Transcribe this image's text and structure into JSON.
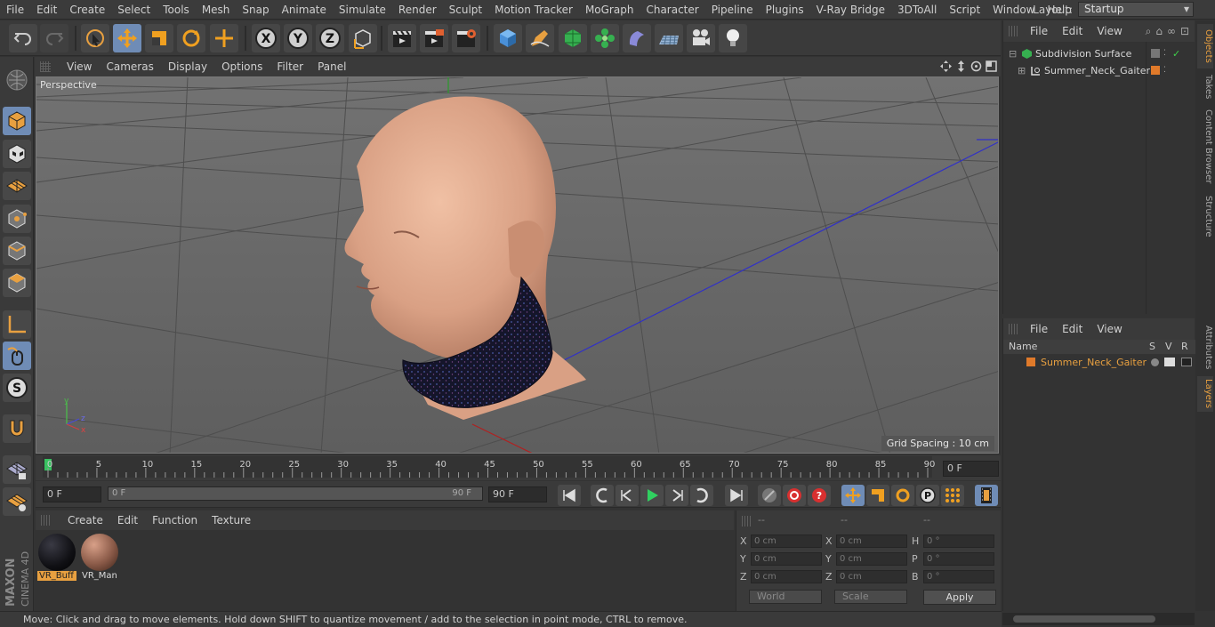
{
  "menubar": {
    "items": [
      "File",
      "Edit",
      "Create",
      "Select",
      "Tools",
      "Mesh",
      "Snap",
      "Animate",
      "Simulate",
      "Render",
      "Sculpt",
      "Motion Tracker",
      "MoGraph",
      "Character",
      "Pipeline",
      "Plugins",
      "V-Ray Bridge",
      "3DToAll",
      "Script",
      "Window",
      "Help"
    ],
    "layout_label": "Layout:",
    "layout_value": "Startup"
  },
  "toolbar": {
    "axis_x": "X",
    "axis_y": "Y",
    "axis_z": "Z"
  },
  "viewport": {
    "menu": [
      "View",
      "Cameras",
      "Display",
      "Options",
      "Filter",
      "Panel"
    ],
    "label": "Perspective",
    "grid_spacing": "Grid Spacing : 10 cm",
    "axis_y": "y",
    "axis_z": "z",
    "axis_x": "x"
  },
  "timeline": {
    "ticks": [
      "0",
      "5",
      "10",
      "15",
      "20",
      "25",
      "30",
      "35",
      "40",
      "45",
      "50",
      "55",
      "60",
      "65",
      "70",
      "75",
      "80",
      "85",
      "90"
    ],
    "current_frame": "0 F"
  },
  "transport": {
    "start_field": "0 F",
    "range_start": "0 F",
    "range_end": "90 F",
    "end_field": "90 F"
  },
  "materials": {
    "menu": [
      "Create",
      "Edit",
      "Function",
      "Texture"
    ],
    "items": [
      {
        "label": "VR_Buff",
        "color": "#101014"
      },
      {
        "label": "VR_Man",
        "color": "#8a5a48"
      }
    ]
  },
  "coordinates": {
    "header": [
      "--",
      "--",
      "--"
    ],
    "rows": [
      {
        "l1": "X",
        "v1": "0 cm",
        "l2": "X",
        "v2": "0 cm",
        "l3": "H",
        "v3": "0 °"
      },
      {
        "l1": "Y",
        "v1": "0 cm",
        "l2": "Y",
        "v2": "0 cm",
        "l3": "P",
        "v3": "0 °"
      },
      {
        "l1": "Z",
        "v1": "0 cm",
        "l2": "Z",
        "v2": "0 cm",
        "l3": "B",
        "v3": "0 °"
      }
    ],
    "mode_world": "World",
    "mode_scale": "Scale",
    "apply": "Apply"
  },
  "status": {
    "text": "Move: Click and drag to move elements. Hold down SHIFT to quantize movement / add to the selection in point mode, CTRL to remove."
  },
  "objects_panel": {
    "menu": [
      "File",
      "Edit",
      "View"
    ],
    "items": [
      {
        "name": "Subdivision Surface"
      },
      {
        "name": "Summer_Neck_Gaiter"
      }
    ]
  },
  "layers_panel": {
    "menu": [
      "File",
      "Edit",
      "View"
    ],
    "col_name": "Name",
    "col_s": "S",
    "col_v": "V",
    "col_r": "R",
    "items": [
      {
        "name": "Summer_Neck_Gaiter",
        "color": "#e07a2a"
      }
    ]
  },
  "right_tabs": [
    "Objects",
    "Takes",
    "Content Browser",
    "Structure",
    "Attributes",
    "Layers"
  ],
  "colors": {
    "accent": "#6f8cb6",
    "orange": "#e8a040",
    "viewport_bg": "#6b6b6b"
  }
}
